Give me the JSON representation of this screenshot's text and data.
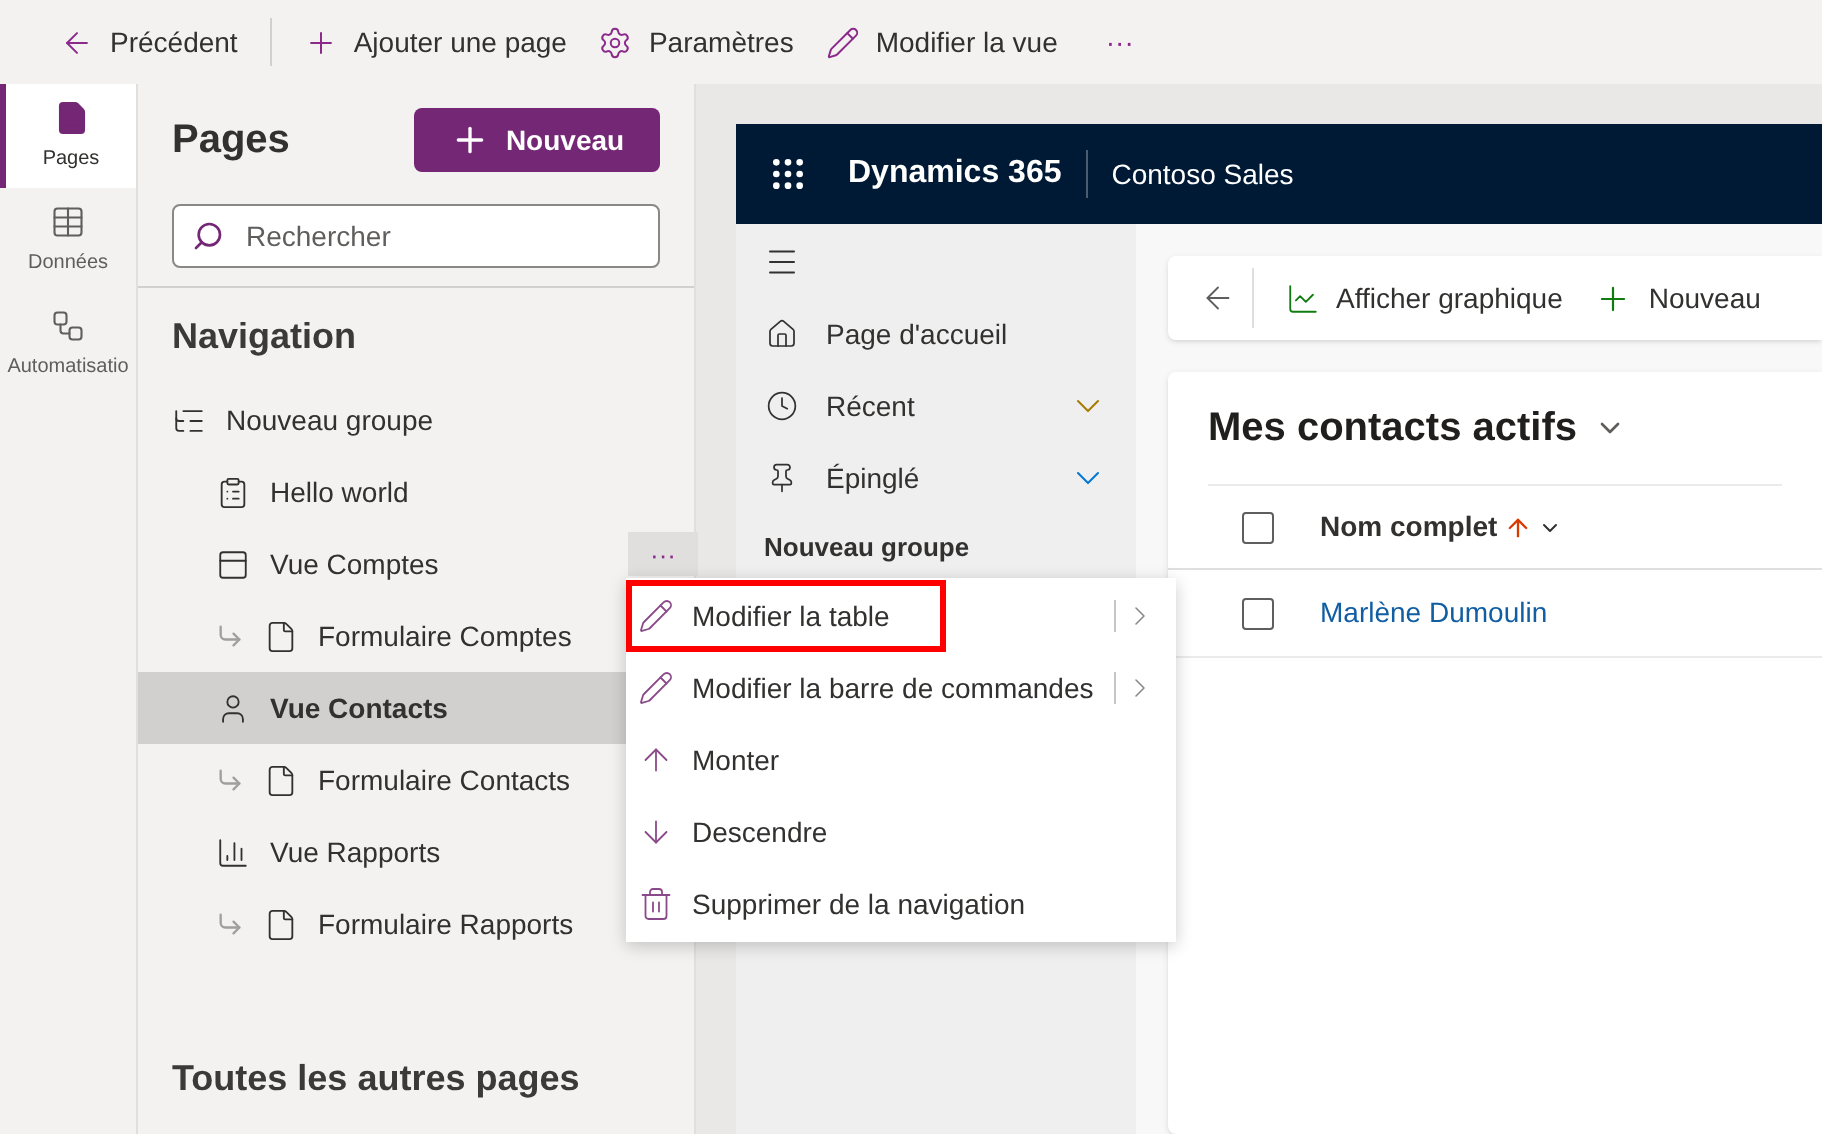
{
  "toolbar": [
    {
      "kind": "back",
      "label": "Précédent"
    },
    {
      "kind": "add",
      "label": "Ajouter une page"
    },
    {
      "kind": "settings",
      "label": "Paramètres"
    },
    {
      "kind": "edit",
      "label": "Modifier la vue"
    },
    {
      "kind": "more",
      "label": "···"
    }
  ],
  "rail": [
    {
      "kind": "pages",
      "label": "Pages",
      "selected": true
    },
    {
      "kind": "data",
      "label": "Données",
      "selected": false
    },
    {
      "kind": "flow",
      "label": "Automatisatio",
      "selected": false
    }
  ],
  "pages_panel": {
    "title": "Pages",
    "new_button": "Nouveau",
    "search": {
      "placeholder": "Rechercher"
    },
    "navigation_heading": "Navigation",
    "tree": [
      {
        "kind": "group",
        "label": "Nouveau groupe",
        "selected": false,
        "children": [
          {
            "kind": "dashboard",
            "label": "Hello world",
            "selected": false
          },
          {
            "kind": "view",
            "label": "Vue Comptes",
            "selected": false,
            "more_button": "···",
            "children": [
              {
                "kind": "form",
                "label": "Formulaire Comptes",
                "selected": false
              }
            ]
          },
          {
            "kind": "contact",
            "label": "Vue Contacts",
            "selected": true,
            "children": [
              {
                "kind": "form",
                "label": "Formulaire Contacts",
                "selected": false
              }
            ]
          },
          {
            "kind": "report",
            "label": "Vue Rapports",
            "selected": false,
            "children": [
              {
                "kind": "form",
                "label": "Formulaire Rapports",
                "selected": false
              }
            ]
          }
        ]
      }
    ],
    "other_pages_heading": "Toutes les autres pages"
  },
  "context_menu": [
    {
      "kind": "edit",
      "label": "Modifier la table",
      "submenu": true,
      "highlighted": true
    },
    {
      "kind": "edit",
      "label": "Modifier la barre de commandes",
      "submenu": true,
      "highlighted": false
    },
    {
      "kind": "up",
      "label": "Monter",
      "submenu": false,
      "highlighted": false
    },
    {
      "kind": "down",
      "label": "Descendre",
      "submenu": false,
      "highlighted": false
    },
    {
      "kind": "delete",
      "label": "Supprimer de la navigation",
      "submenu": false,
      "highlighted": false
    }
  ],
  "preview": {
    "app_name": "Dynamics 365",
    "area_name": "Contoso Sales",
    "sitemap": [
      {
        "kind": "home",
        "label": "Page d'accueil",
        "expandable": false
      },
      {
        "kind": "recent",
        "label": "Récent",
        "expandable": true
      },
      {
        "kind": "pinned",
        "label": "Épinglé",
        "expandable": true
      }
    ],
    "sitemap_group": "Nouveau groupe",
    "commands": [
      {
        "kind": "chart",
        "label": "Afficher graphique"
      },
      {
        "kind": "add",
        "label": "Nouveau"
      }
    ],
    "view_title": "Mes contacts actifs",
    "columns": [
      {
        "label": "Nom complet",
        "sorted": true,
        "select_all_checked": false
      }
    ],
    "rows": [
      {
        "name": "Marlène Dumoulin",
        "checked": false
      }
    ]
  }
}
